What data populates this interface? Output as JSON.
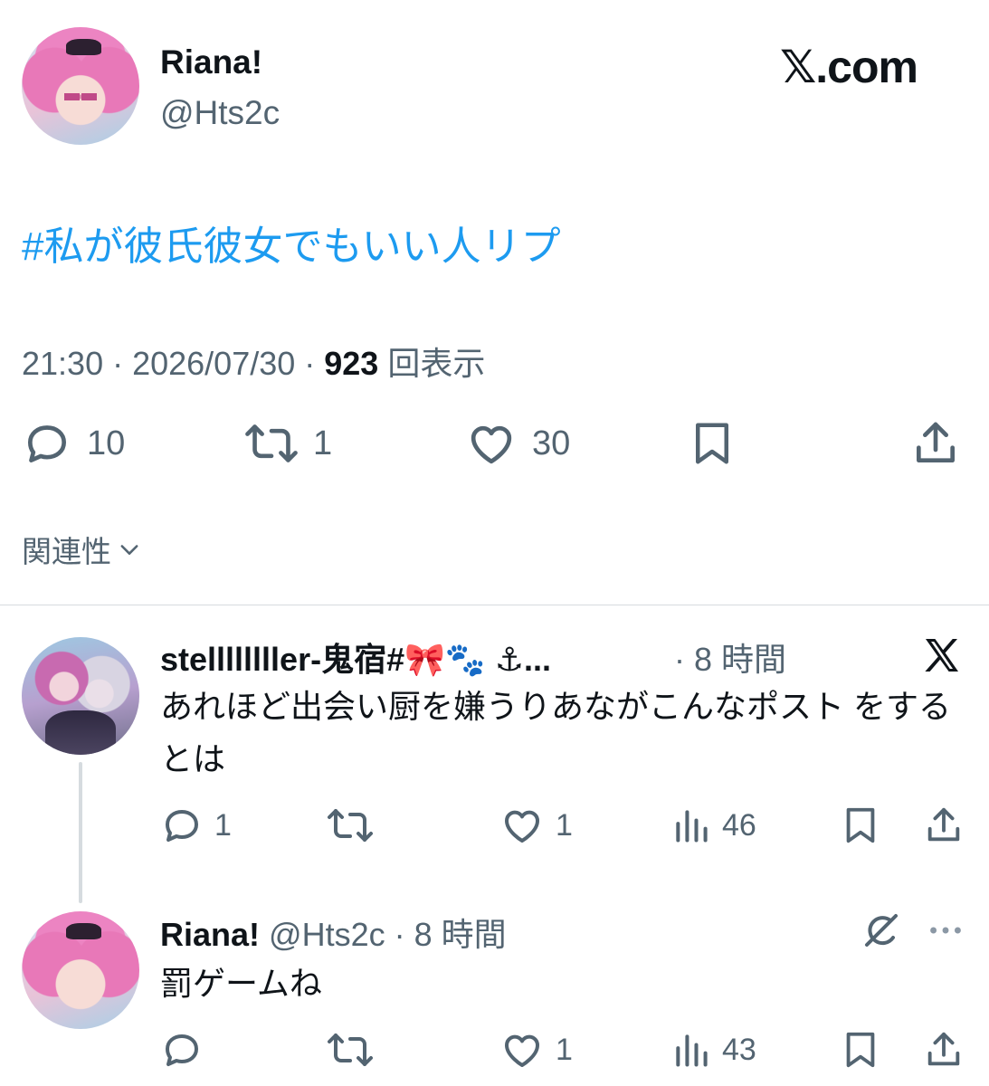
{
  "post": {
    "author_name": "Riana!",
    "author_handle": "@Hts2c",
    "brand": "𝕏.com",
    "text": "#私が彼氏彼女でもいい人リプ",
    "time": "21:30 · 2026/07/30 · ",
    "views_count": "923",
    "views_label": "回表示",
    "stats": {
      "replies": "10",
      "reposts": "1",
      "likes": "30"
    }
  },
  "sort": {
    "label": "関連性"
  },
  "replies": [
    {
      "author_name": "stellllllller-鬼宿#🎀🐾 ⚓...",
      "time": "· 8 時間",
      "text": "あれほど出会い厨を嫌うりあながこんなポスト をするとは",
      "stats": {
        "replies": "1",
        "reposts": "",
        "likes": "1",
        "views": "46"
      }
    },
    {
      "author_name": "Riana!",
      "author_handle": "@Hts2c",
      "time": "· 8 時間",
      "text": "罰ゲームね",
      "stats": {
        "replies": "",
        "reposts": "",
        "likes": "1",
        "views": "43"
      }
    }
  ],
  "colors": {
    "link": "#1d9bf0",
    "secondary_text": "#536471",
    "primary_text": "#0f1419",
    "divider": "#d6dbdf"
  },
  "icons": [
    "reply-icon",
    "repost-icon",
    "like-icon",
    "bookmark-icon",
    "share-icon",
    "views-icon",
    "x-logo-icon",
    "grok-icon",
    "more-icon",
    "chevron-down-icon"
  ]
}
